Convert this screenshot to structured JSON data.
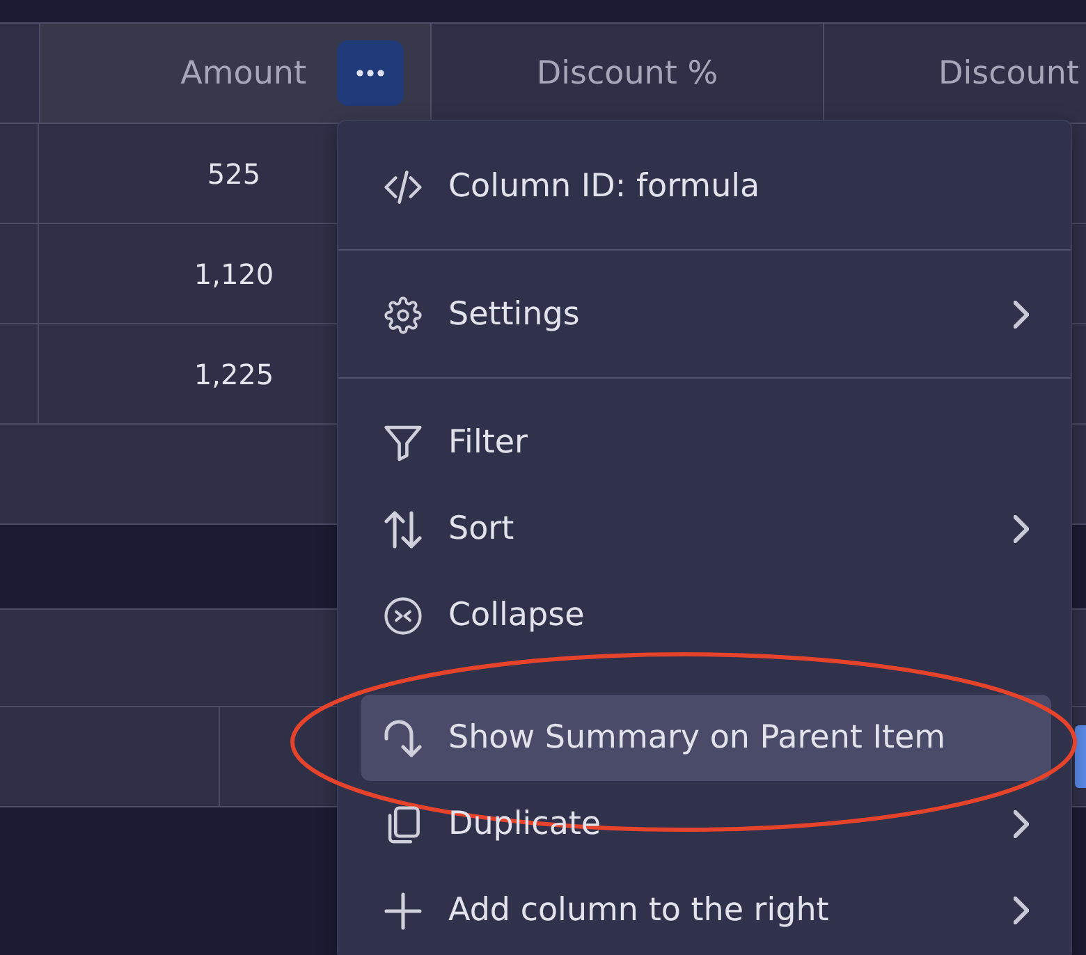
{
  "table": {
    "columns": [
      {
        "label": "Amount",
        "selected": true
      },
      {
        "label": "Discount %",
        "selected": false
      },
      {
        "label": "Discount",
        "selected": false
      }
    ],
    "rows": [
      {
        "amount": "525"
      },
      {
        "amount": "1,120"
      },
      {
        "amount": "1,225"
      }
    ]
  },
  "column_menu": {
    "sections": [
      {
        "items": [
          {
            "kind": "column-id",
            "label": "Column ID: formula",
            "submenu": false,
            "highlighted": false,
            "circled": false
          }
        ]
      },
      {
        "items": [
          {
            "kind": "settings",
            "label": "Settings",
            "submenu": true,
            "highlighted": false,
            "circled": false
          }
        ]
      },
      {
        "items": [
          {
            "kind": "filter",
            "label": "Filter",
            "submenu": false,
            "highlighted": false,
            "circled": false
          },
          {
            "kind": "sort",
            "label": "Sort",
            "submenu": true,
            "highlighted": false,
            "circled": false
          },
          {
            "kind": "collapse",
            "label": "Collapse",
            "submenu": false,
            "highlighted": false,
            "circled": false
          },
          {
            "kind": "summary",
            "label": "Show Summary on Parent Item",
            "submenu": false,
            "highlighted": true,
            "circled": true
          },
          {
            "kind": "duplicate",
            "label": "Duplicate",
            "submenu": true,
            "highlighted": false,
            "circled": false
          },
          {
            "kind": "add-column",
            "label": "Add column to the right",
            "submenu": true,
            "highlighted": false,
            "circled": false
          }
        ]
      }
    ]
  }
}
